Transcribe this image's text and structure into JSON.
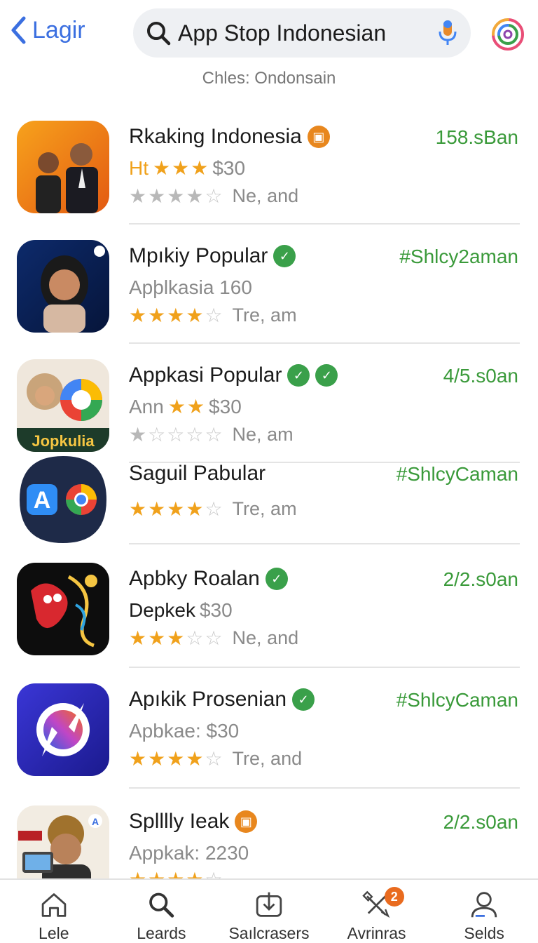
{
  "header": {
    "back_label": "Lagir",
    "search_query": "App Stop Indonesian",
    "subtitle": "Chles: Ondonsain"
  },
  "apps": [
    {
      "title": "Rkaking Indonesia",
      "badge_color": "orange",
      "badges": 1,
      "meta": "158.sBan",
      "line2_prefix": "Ht",
      "line2_prefix_stars": 3,
      "line2": "$30",
      "rating": 4,
      "rating_color": "grey",
      "rating_text": "Ne, and"
    },
    {
      "title": "Mpıkiy Popular",
      "badge_color": "green",
      "badges": 1,
      "meta": "#Shlcy2aman",
      "line2_prefix": "",
      "line2_prefix_stars": 0,
      "line2": "Apþlkasia 160",
      "rating": 4,
      "rating_color": "gold",
      "rating_text": "Tre, am"
    },
    {
      "title": "Appkasi Popular",
      "badge_color": "green",
      "badges": 2,
      "meta": "4/5.s0an",
      "line2_prefix": "Ann",
      "line2_prefix_stars": 2,
      "line2": "$30",
      "rating": 1,
      "rating_color": "grey",
      "rating_text": "Ne, am"
    },
    {
      "title": "Saguil Pabular",
      "badge_color": "",
      "badges": 0,
      "meta": "#ShlcyCaman",
      "line2_prefix": "",
      "line2_prefix_stars": 0,
      "line2": "",
      "rating": 4,
      "rating_color": "gold",
      "rating_text": "Tre, am"
    },
    {
      "title": "Apbky Roalan",
      "badge_color": "green",
      "badges": 1,
      "meta": "2/2.s0an",
      "line2_prefix": "Depkek",
      "line2_prefix_stars": 0,
      "line2": "$30",
      "rating": 3,
      "rating_color": "gold",
      "rating_text": "Ne, and"
    },
    {
      "title": "Apıkik Prosenian",
      "badge_color": "green",
      "badges": 1,
      "meta": "#ShlcyCaman",
      "line2_prefix": "",
      "line2_prefix_stars": 0,
      "line2": "Apbkae: $30",
      "rating": 4,
      "rating_color": "gold",
      "rating_text": "Tre, and"
    },
    {
      "title": "Splllly Ieak",
      "badge_color": "orange",
      "badges": 1,
      "meta": "2/2.s0an",
      "line2_prefix": "",
      "line2_prefix_stars": 0,
      "line2": "Appkak: 2230",
      "rating": 4,
      "rating_color": "gold",
      "rating_text": ""
    }
  ],
  "nav": [
    {
      "label": "Lele",
      "icon": "home-icon"
    },
    {
      "label": "Leards",
      "icon": "search-icon"
    },
    {
      "label": "Saılcrasers",
      "icon": "download-icon"
    },
    {
      "label": "Avrinras",
      "icon": "tools-icon",
      "badge": "2"
    },
    {
      "label": "Selds",
      "icon": "person-icon"
    }
  ],
  "colors": {
    "accent_blue": "#3b6fe0",
    "green": "#3a9a3a",
    "star": "#f0a11b",
    "badge_orange": "#e96b1f"
  }
}
